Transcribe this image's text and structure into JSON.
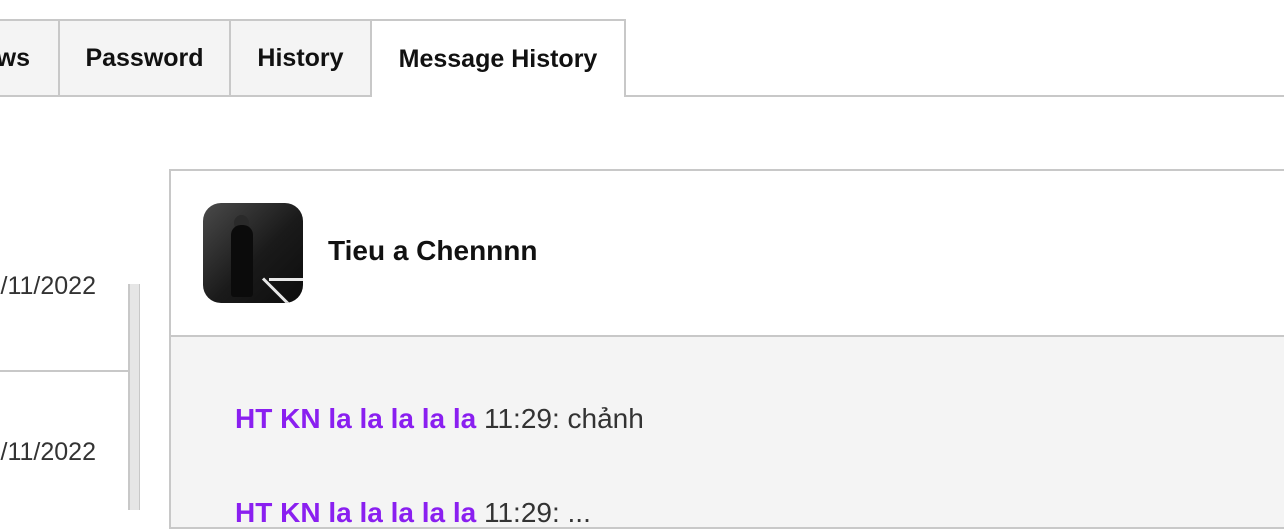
{
  "tabs": [
    {
      "label": "ws",
      "active": false
    },
    {
      "label": "Password",
      "active": false
    },
    {
      "label": "History",
      "active": false
    },
    {
      "label": "Message History",
      "active": true
    }
  ],
  "left_list": {
    "items": [
      {
        "date": "/11/2022"
      },
      {
        "date": "/11/2022"
      }
    ]
  },
  "chat": {
    "contact_name": "Tieu a Chennnn",
    "avatar_icon": "contact-avatar",
    "messages": [
      {
        "sender": "HT KN la la la la la",
        "meta": " 11:29: chảnh"
      },
      {
        "sender": "HT KN la la la la la",
        "meta": " 11:29: ..."
      }
    ]
  },
  "colors": {
    "accent_sender": "#8a1ff0",
    "border": "#c8c8c8",
    "panel_bg": "#f4f4f4"
  }
}
